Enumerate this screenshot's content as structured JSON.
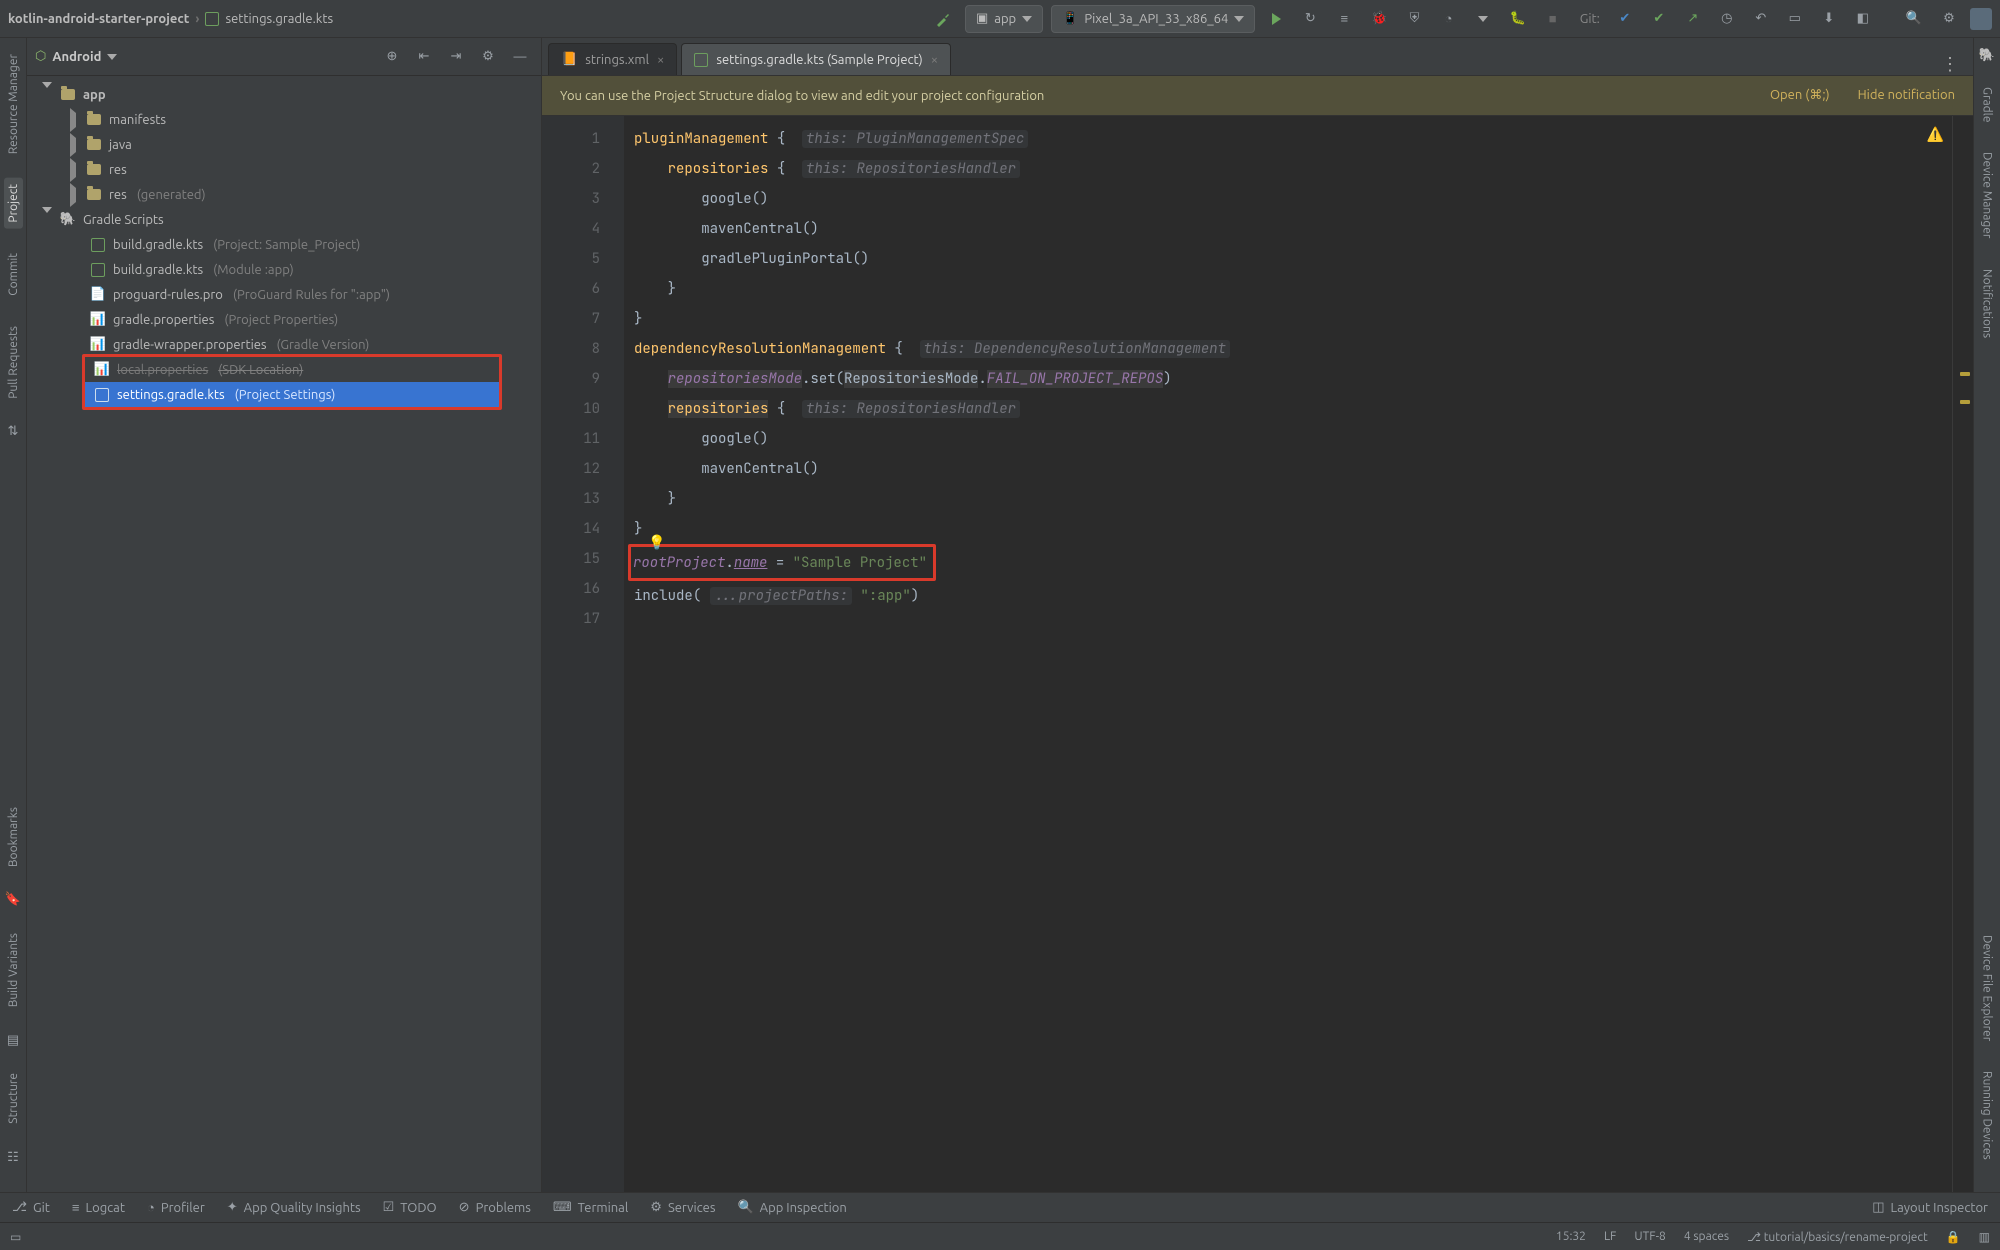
{
  "breadcrumb": {
    "project": "kotlin-android-starter-project",
    "file": "settings.gradle.kts"
  },
  "runConfig": "app",
  "device": "Pixel_3a_API_33_x86_64",
  "git_label": "Git:",
  "projectPanel": {
    "viewName": "Android",
    "toolbarIcons": [
      "target",
      "collapse",
      "expand",
      "settings",
      "minimize"
    ]
  },
  "tree": {
    "app": "app",
    "manifests": "manifests",
    "java": "java",
    "res": "res",
    "res_gen": "res",
    "res_gen_dim": "(generated)",
    "gradle_scripts": "Gradle Scripts",
    "build_proj": "build.gradle.kts",
    "build_proj_dim": "(Project: Sample_Project)",
    "build_mod": "build.gradle.kts",
    "build_mod_dim": "(Module :app)",
    "proguard": "proguard-rules.pro",
    "proguard_dim": "(ProGuard Rules for \":app\")",
    "gradle_props": "gradle.properties",
    "gradle_props_dim": "(Project Properties)",
    "wrapper_props": "gradle-wrapper.properties",
    "wrapper_props_dim": "(Gradle Version)",
    "local_props": "local.properties",
    "local_props_dim": "(SDK Location)",
    "settings": "settings.gradle.kts",
    "settings_dim": "(Project Settings)"
  },
  "left_tools": {
    "resource_mgr": "Resource Manager",
    "project": "Project",
    "commit": "Commit",
    "pull_requests": "Pull Requests",
    "bookmarks": "Bookmarks",
    "build_variants": "Build Variants",
    "structure": "Structure"
  },
  "right_tools": {
    "gradle": "Gradle",
    "device_mgr": "Device Manager",
    "notifications": "Notifications",
    "device_file_explorer": "Device File Explorer",
    "running_devices": "Running Devices"
  },
  "editor_tabs": {
    "tab1": "strings.xml",
    "tab2": "settings.gradle.kts (Sample Project)"
  },
  "banner": {
    "msg": "You can use the Project Structure dialog to view and edit your project configuration",
    "open": "Open (⌘;)",
    "hide": "Hide notification"
  },
  "code": {
    "l1_a": "pluginManagement",
    "l1_b": "{",
    "l1_hint": "this: PluginManagementSpec",
    "l2_a": "repositories",
    "l2_b": "{",
    "l2_hint": "this: RepositoriesHandler",
    "l3": "google()",
    "l4": "mavenCentral()",
    "l5": "gradlePluginPortal()",
    "l6": "}",
    "l7": "}",
    "l8_a": "dependencyResolutionManagement",
    "l8_b": "{",
    "l8_hint": "this: DependencyResolutionManagement",
    "l9_a": "repositoriesMode",
    "l9_b": ".set(",
    "l9_c": "RepositoriesMode",
    "l9_d": ".",
    "l9_e": "FAIL_ON_PROJECT_REPOS",
    "l9_f": ")",
    "l10_a": "repositories",
    "l10_b": "{",
    "l10_hint": "this: RepositoriesHandler",
    "l11": "google()",
    "l12": "mavenCentral()",
    "l13": "}",
    "l14": "}",
    "l15_a": "rootProject",
    "l15_b": ".",
    "l15_c": "name",
    "l15_d": " = ",
    "l15_e": "\"Sample Project\"",
    "l16_a": "include(",
    "l16_hint": "...projectPaths:",
    "l16_b": "\":app\"",
    "l16_c": ")"
  },
  "bottom_tools": {
    "git": "Git",
    "logcat": "Logcat",
    "profiler": "Profiler",
    "app_quality": "App Quality Insights",
    "todo": "TODO",
    "problems": "Problems",
    "terminal": "Terminal",
    "services": "Services",
    "app_inspection": "App Inspection",
    "layout_inspector": "Layout Inspector"
  },
  "status": {
    "pos": "15:32",
    "le": "LF",
    "enc": "UTF-8",
    "indent": "4 spaces",
    "branch": "tutorial/basics/rename-project"
  }
}
